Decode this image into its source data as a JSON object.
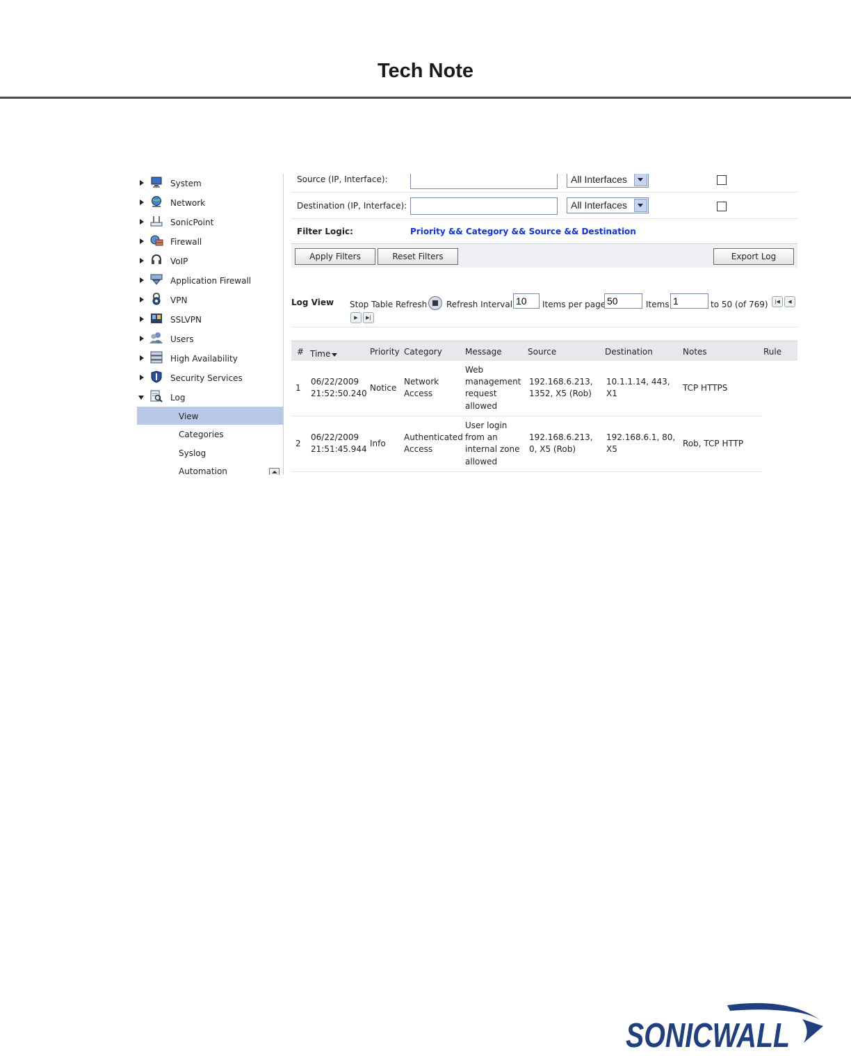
{
  "header": {
    "title": "Tech Note"
  },
  "sidebar": {
    "items": [
      {
        "label": "System",
        "icon": "monitor-icon"
      },
      {
        "label": "Network",
        "icon": "globe-icon"
      },
      {
        "label": "SonicPoint",
        "icon": "access-point-icon"
      },
      {
        "label": "Firewall",
        "icon": "firewall-icon"
      },
      {
        "label": "VoIP",
        "icon": "headset-icon"
      },
      {
        "label": "Application Firewall",
        "icon": "app-firewall-icon"
      },
      {
        "label": "VPN",
        "icon": "lock-icon"
      },
      {
        "label": "SSLVPN",
        "icon": "sslvpn-icon"
      },
      {
        "label": "Users",
        "icon": "users-icon"
      },
      {
        "label": "High Availability",
        "icon": "server-icon"
      },
      {
        "label": "Security Services",
        "icon": "shield-icon"
      },
      {
        "label": "Log",
        "icon": "log-search-icon"
      }
    ],
    "log_sub": [
      "View",
      "Categories",
      "Syslog",
      "Automation"
    ],
    "active_sub": "View"
  },
  "filters": {
    "source_label": "Source (IP, Interface):",
    "destination_label": "Destination (IP, Interface):",
    "source_value": "",
    "destination_value": "",
    "interface_option": "All Interfaces",
    "logic_label": "Filter Logic:",
    "logic_value": "Priority && Category && Source && Destination",
    "apply_label": "Apply Filters",
    "reset_label": "Reset Filters",
    "export_label": "Export Log"
  },
  "log_view": {
    "title": "Log View",
    "stop_refresh": "Stop Table Refresh",
    "refresh_interval_label": "Refresh Interval",
    "refresh_interval": "10",
    "items_per_page_label": "Items per page",
    "items_per_page": "50",
    "items_label": "Items",
    "items_start": "1",
    "range_text": "to 50 (of 769)"
  },
  "table": {
    "columns": [
      "#",
      "Time",
      "Priority",
      "Category",
      "Message",
      "Source",
      "Destination",
      "Notes",
      "Rule"
    ],
    "rows": [
      {
        "num": "1",
        "time": [
          "06/22/2009",
          "21:52:50.240"
        ],
        "priority": "Notice",
        "category": [
          "Network",
          "Access"
        ],
        "message": [
          "Web",
          "management",
          "request",
          "allowed"
        ],
        "source": [
          "192.168.6.213,",
          "1352, X5 (Rob)"
        ],
        "destination": [
          "10.1.1.14, 443,",
          "X1"
        ],
        "notes": "TCP HTTPS",
        "rule": ""
      },
      {
        "num": "2",
        "time": [
          "06/22/2009",
          "21:51:45.944"
        ],
        "priority": "Info",
        "category": [
          "Authenticated",
          "Access"
        ],
        "message": [
          "User login",
          "from an",
          "internal zone",
          "allowed"
        ],
        "source": [
          "192.168.6.213,",
          "0, X5 (Rob)"
        ],
        "destination": [
          "192.168.6.1, 80,",
          "X5"
        ],
        "notes": "Rob, TCP HTTP",
        "rule": ""
      }
    ]
  },
  "footer": {
    "logo_text": "SONICWALL",
    "brand_color": "#1f3f7f"
  }
}
